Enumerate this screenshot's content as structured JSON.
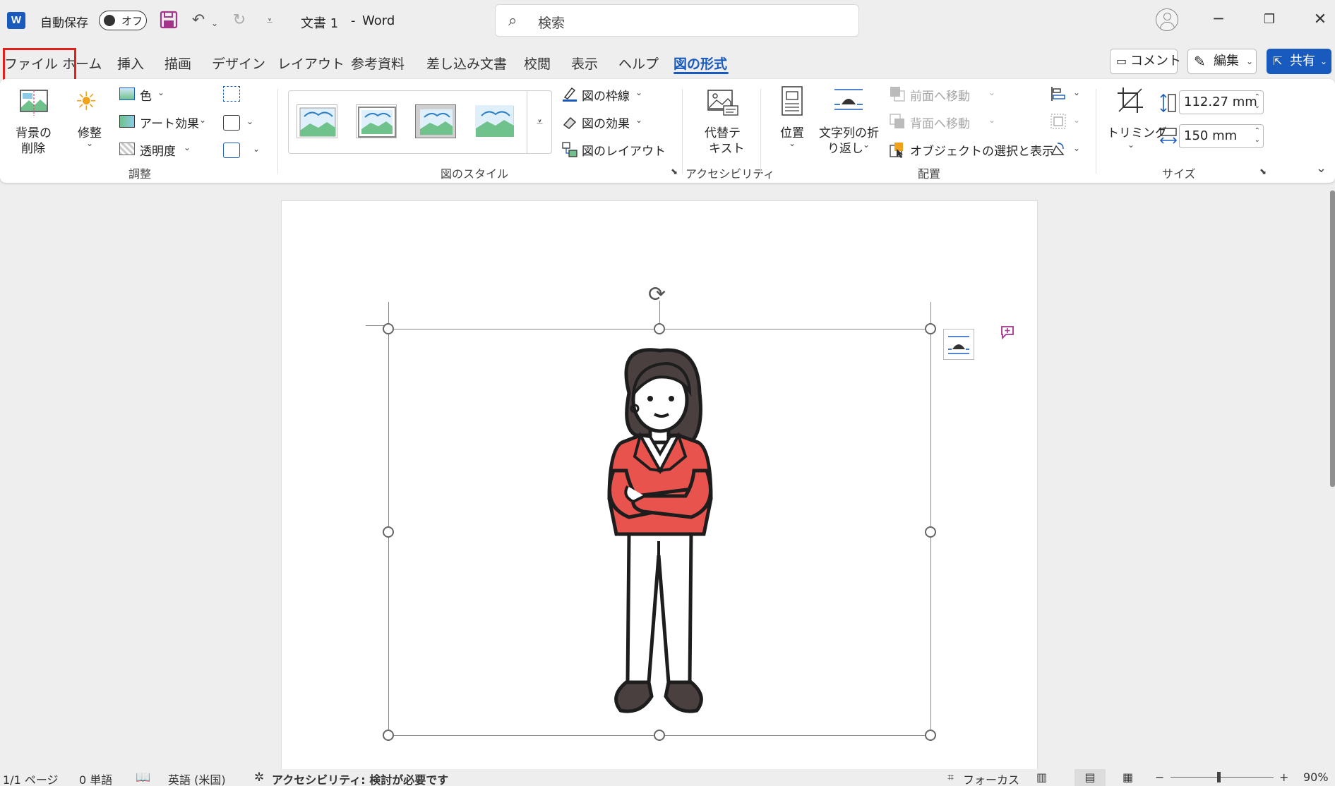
{
  "titlebar": {
    "app_icon": "word-icon",
    "autosave_label": "自動保存",
    "autosave_state": "オフ",
    "doc_title": "文書 1",
    "separator": "-",
    "app_name": "Word",
    "search_placeholder": "検索"
  },
  "tabs": [
    {
      "label": "ファイル"
    },
    {
      "label": "ホーム"
    },
    {
      "label": "挿入"
    },
    {
      "label": "描画"
    },
    {
      "label": "デザイン"
    },
    {
      "label": "レイアウト"
    },
    {
      "label": "参考資料"
    },
    {
      "label": "差し込み文書"
    },
    {
      "label": "校閲"
    },
    {
      "label": "表示"
    },
    {
      "label": "ヘルプ"
    },
    {
      "label": "図の形式",
      "active": true
    }
  ],
  "right_buttons": {
    "comment": "コメント",
    "edit": "編集",
    "share": "共有"
  },
  "ribbon": {
    "adjust": {
      "remove_bg_line1": "背景の",
      "remove_bg_line2": "削除",
      "corrections": "修整",
      "color": "色",
      "artistic_effects": "アート効果",
      "transparency": "透明度",
      "group_label": "調整"
    },
    "styles": {
      "border": "図の枠線",
      "effects": "図の効果",
      "layout": "図のレイアウト",
      "group_label": "図のスタイル"
    },
    "accessibility": {
      "alt_text_line1": "代替テ",
      "alt_text_line2": "キスト",
      "group_label": "アクセシビリティ"
    },
    "arrange": {
      "position": "位置",
      "wrap_line1": "文字列の折",
      "wrap_line2": "り返し",
      "bring_forward": "前面へ移動",
      "send_backward": "背面へ移動",
      "selection_pane": "オブジェクトの選択と表示",
      "group_label": "配置"
    },
    "size": {
      "crop": "トリミング",
      "height": "112.27 mm",
      "width": "150 mm",
      "group_label": "サイズ"
    }
  },
  "statusbar": {
    "page": "1/1 ページ",
    "words": "0 単語",
    "language": "英語 (米国)",
    "accessibility": "アクセシビリティ: 検討が必要です",
    "focus": "フォーカス",
    "zoom": "90%"
  },
  "colors": {
    "accent": "#185abd",
    "highlight_box": "#e0201b",
    "jacket": "#e8534d",
    "hair": "#4a4040"
  }
}
